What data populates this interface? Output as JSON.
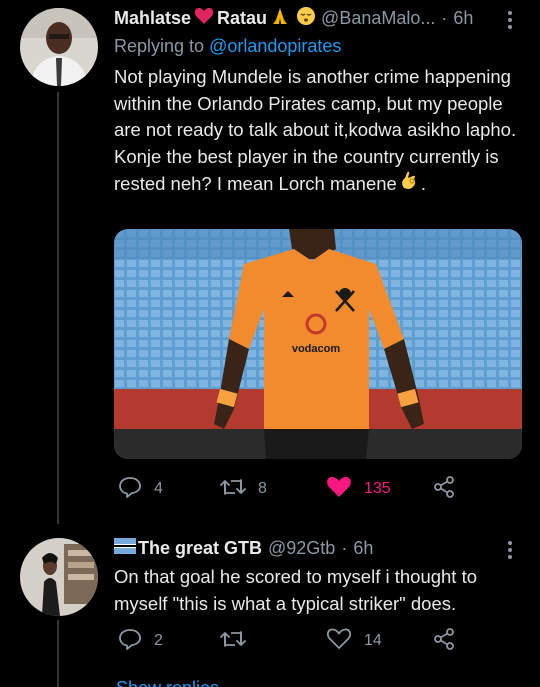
{
  "tweet1": {
    "name": "Mahlatse",
    "name_part2": "Ratau",
    "name_emojis": [
      "red-heart",
      "folded-hands",
      "relieved-face"
    ],
    "handle": "@BanaMalo...",
    "time_sep": "·",
    "time": "6h",
    "replying_prefix": "Replying to",
    "replying_handle": "@orlandopirates",
    "text": "Not playing Mundele is another crime happening within the Orlando Pirates camp, but my people are not ready to talk about it,kodwa asikho lapho. Konje the best player in the country currently is rested neh? I mean Lorch manene",
    "text_tail": ".",
    "media_kit_text": "vodacom",
    "stats": {
      "replies": "4",
      "retweets": "8",
      "likes": "135"
    }
  },
  "tweet2": {
    "name": "The great GTB",
    "handle": "@92Gtb",
    "time_sep": "·",
    "time": "6h",
    "text": "On that goal he scored to myself i thought to myself \"this is what a typical striker\" does.",
    "stats": {
      "replies": "2",
      "retweets": "",
      "likes": "14"
    }
  },
  "colors": {
    "background": "#000000",
    "text": "#e7e9ea",
    "muted": "#8b98a5",
    "link": "#1d9bf0",
    "like": "#f91880"
  },
  "partial": {
    "text": "Show replies"
  }
}
